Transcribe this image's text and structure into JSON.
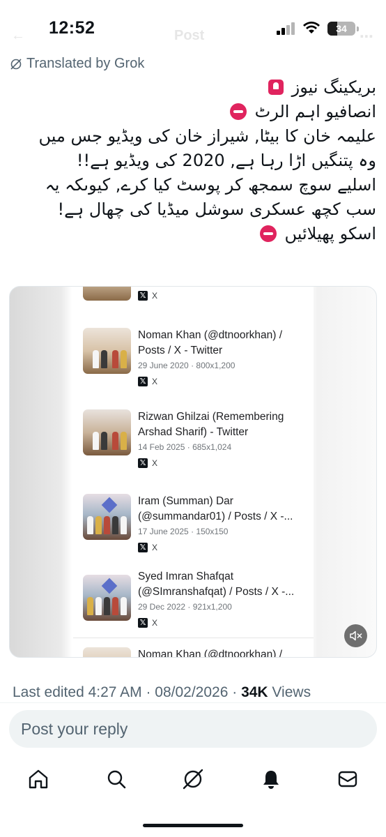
{
  "status_bar": {
    "time": "12:52",
    "battery": "34",
    "battery_level": 0.34
  },
  "faint_header": {
    "back": "←",
    "title": "Post",
    "more": "⋯"
  },
  "translated_label": "Translated by Grok",
  "post_lines": [
    "بریکینگ نیوز",
    "انصافیو اہم الرٹ",
    "علیمہ خان کا بیٹا, شیراز خان کی ویڈیو جس میں",
    "وہ پتنگیں اڑا رہا ہے, 2020 کی ویڈیو ہے!!",
    "اسلیے سوچ سمجھ کر پوسٹ کیا کرے, کیوںکہ یہ",
    "سب کچھ عسکری سوشل میڈیا کی چھال ہے!",
    "اسکو پھیلائیں"
  ],
  "media_results": [
    {
      "title_1": "Noman Khan (@dtnoorkhan) /",
      "title_2": "Posts / X - Twitter",
      "date": "29 June 2020",
      "size": "800x1,200",
      "source": "X"
    },
    {
      "title_1": "Rizwan Ghilzai (Remembering",
      "title_2": "Arshad Sharif) - Twitter",
      "date": "14 Feb 2025",
      "size": "685x1,024",
      "source": "X"
    },
    {
      "title_1": "Iram (Summan) Dar",
      "title_2": "(@summandar01) / Posts / X -...",
      "date": "17 June 2025",
      "size": "150x150",
      "source": "X"
    },
    {
      "title_1": "Syed Imran Shafqat",
      "title_2": "(@SImranshafqat) / Posts / X -...",
      "date": "29 Dec 2022",
      "size": "921x1,200",
      "source": "X"
    }
  ],
  "media_top_source": "X",
  "media_bottom_partial": "Noman Khan (@dtnoorkhan) /",
  "meta": {
    "edited": "Last edited 4:27 AM · 08/02/2026 · ",
    "views_count": "34K",
    "views_label": " Views"
  },
  "reply_placeholder": "Post your reply",
  "tabbar_icons": [
    "home-icon",
    "search-icon",
    "grok-icon",
    "notifications-icon",
    "messages-icon"
  ],
  "colors": {
    "secondary_text": "#536471",
    "text": "#0f1419",
    "reply_bg": "#eff3f4",
    "stop_red": "#e0245e"
  }
}
